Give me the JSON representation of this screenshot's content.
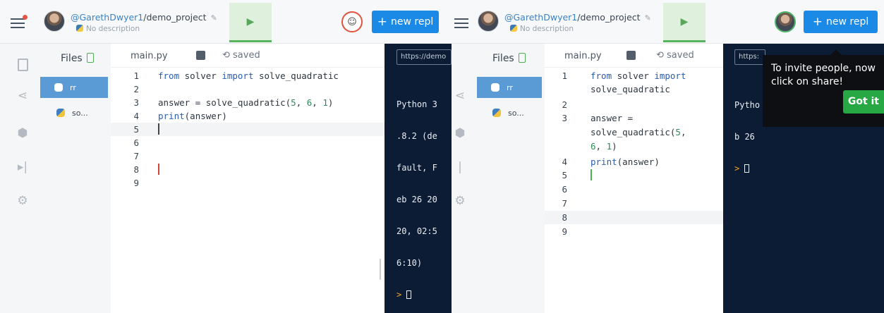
{
  "project": {
    "owner": "@GarethDwyer1",
    "name": "/demo_project",
    "description": "No description"
  },
  "header": {
    "run_icon": "play-icon",
    "new_repl_label": "new repl",
    "new_repl_icon": "plus-icon",
    "invite_icon": "multiplayer-icon"
  },
  "colors": {
    "run_bg": "#dff0dc",
    "run_accent": "#57b45c",
    "new_repl": "#1a8ae6",
    "console_bg": "#0c1c34",
    "active_file": "#5a9bd6",
    "tooltip_button": "#27a844",
    "invite_ring_left": "#e1533e",
    "invite_ring_right": "#4fb36b"
  },
  "sidebar": {
    "icons": [
      "file-icon",
      "share-icon",
      "package-icon",
      "debugger-icon",
      "settings-icon"
    ]
  },
  "files": {
    "title": "Files",
    "items": [
      {
        "label": "rr",
        "active": true
      },
      {
        "label": "so...",
        "active": false
      }
    ]
  },
  "editor": {
    "tab_name": "main.py",
    "status": "saved",
    "left_lines": [
      {
        "n": "1",
        "code": "from solver import solve_quadratic"
      },
      {
        "n": "2",
        "code": ""
      },
      {
        "n": "3",
        "code": "answer = solve_quadratic(5, 6, 1)"
      },
      {
        "n": "4",
        "code": "print(answer)"
      },
      {
        "n": "5",
        "code": ""
      },
      {
        "n": "6",
        "code": ""
      },
      {
        "n": "7",
        "code": ""
      },
      {
        "n": "8",
        "code": ""
      },
      {
        "n": "9",
        "code": ""
      }
    ],
    "right_lines": [
      {
        "n": "1",
        "code": "from solver import"
      },
      {
        "n": "",
        "code": "solve_quadratic"
      },
      {
        "n": "2",
        "code": ""
      },
      {
        "n": "3",
        "code": "answer ="
      },
      {
        "n": "",
        "code": "solve_quadratic(5,"
      },
      {
        "n": "",
        "code": "6, 1)"
      },
      {
        "n": "4",
        "code": "print(answer)"
      },
      {
        "n": "5",
        "code": ""
      },
      {
        "n": "6",
        "code": ""
      },
      {
        "n": "7",
        "code": ""
      },
      {
        "n": "8",
        "code": ""
      },
      {
        "n": "9",
        "code": ""
      }
    ]
  },
  "console": {
    "url_left": "https://demo",
    "url_right": "https:",
    "left_output": [
      "Python 3",
      ".8.2 (de",
      "fault, F",
      "eb 26 20",
      "20, 02:5",
      "6:10)"
    ],
    "right_output": [
      "Pytho",
      "b 26"
    ],
    "prompt": ">"
  },
  "tooltip": {
    "message": "To invite people, now click on share!",
    "button": "Got it"
  }
}
